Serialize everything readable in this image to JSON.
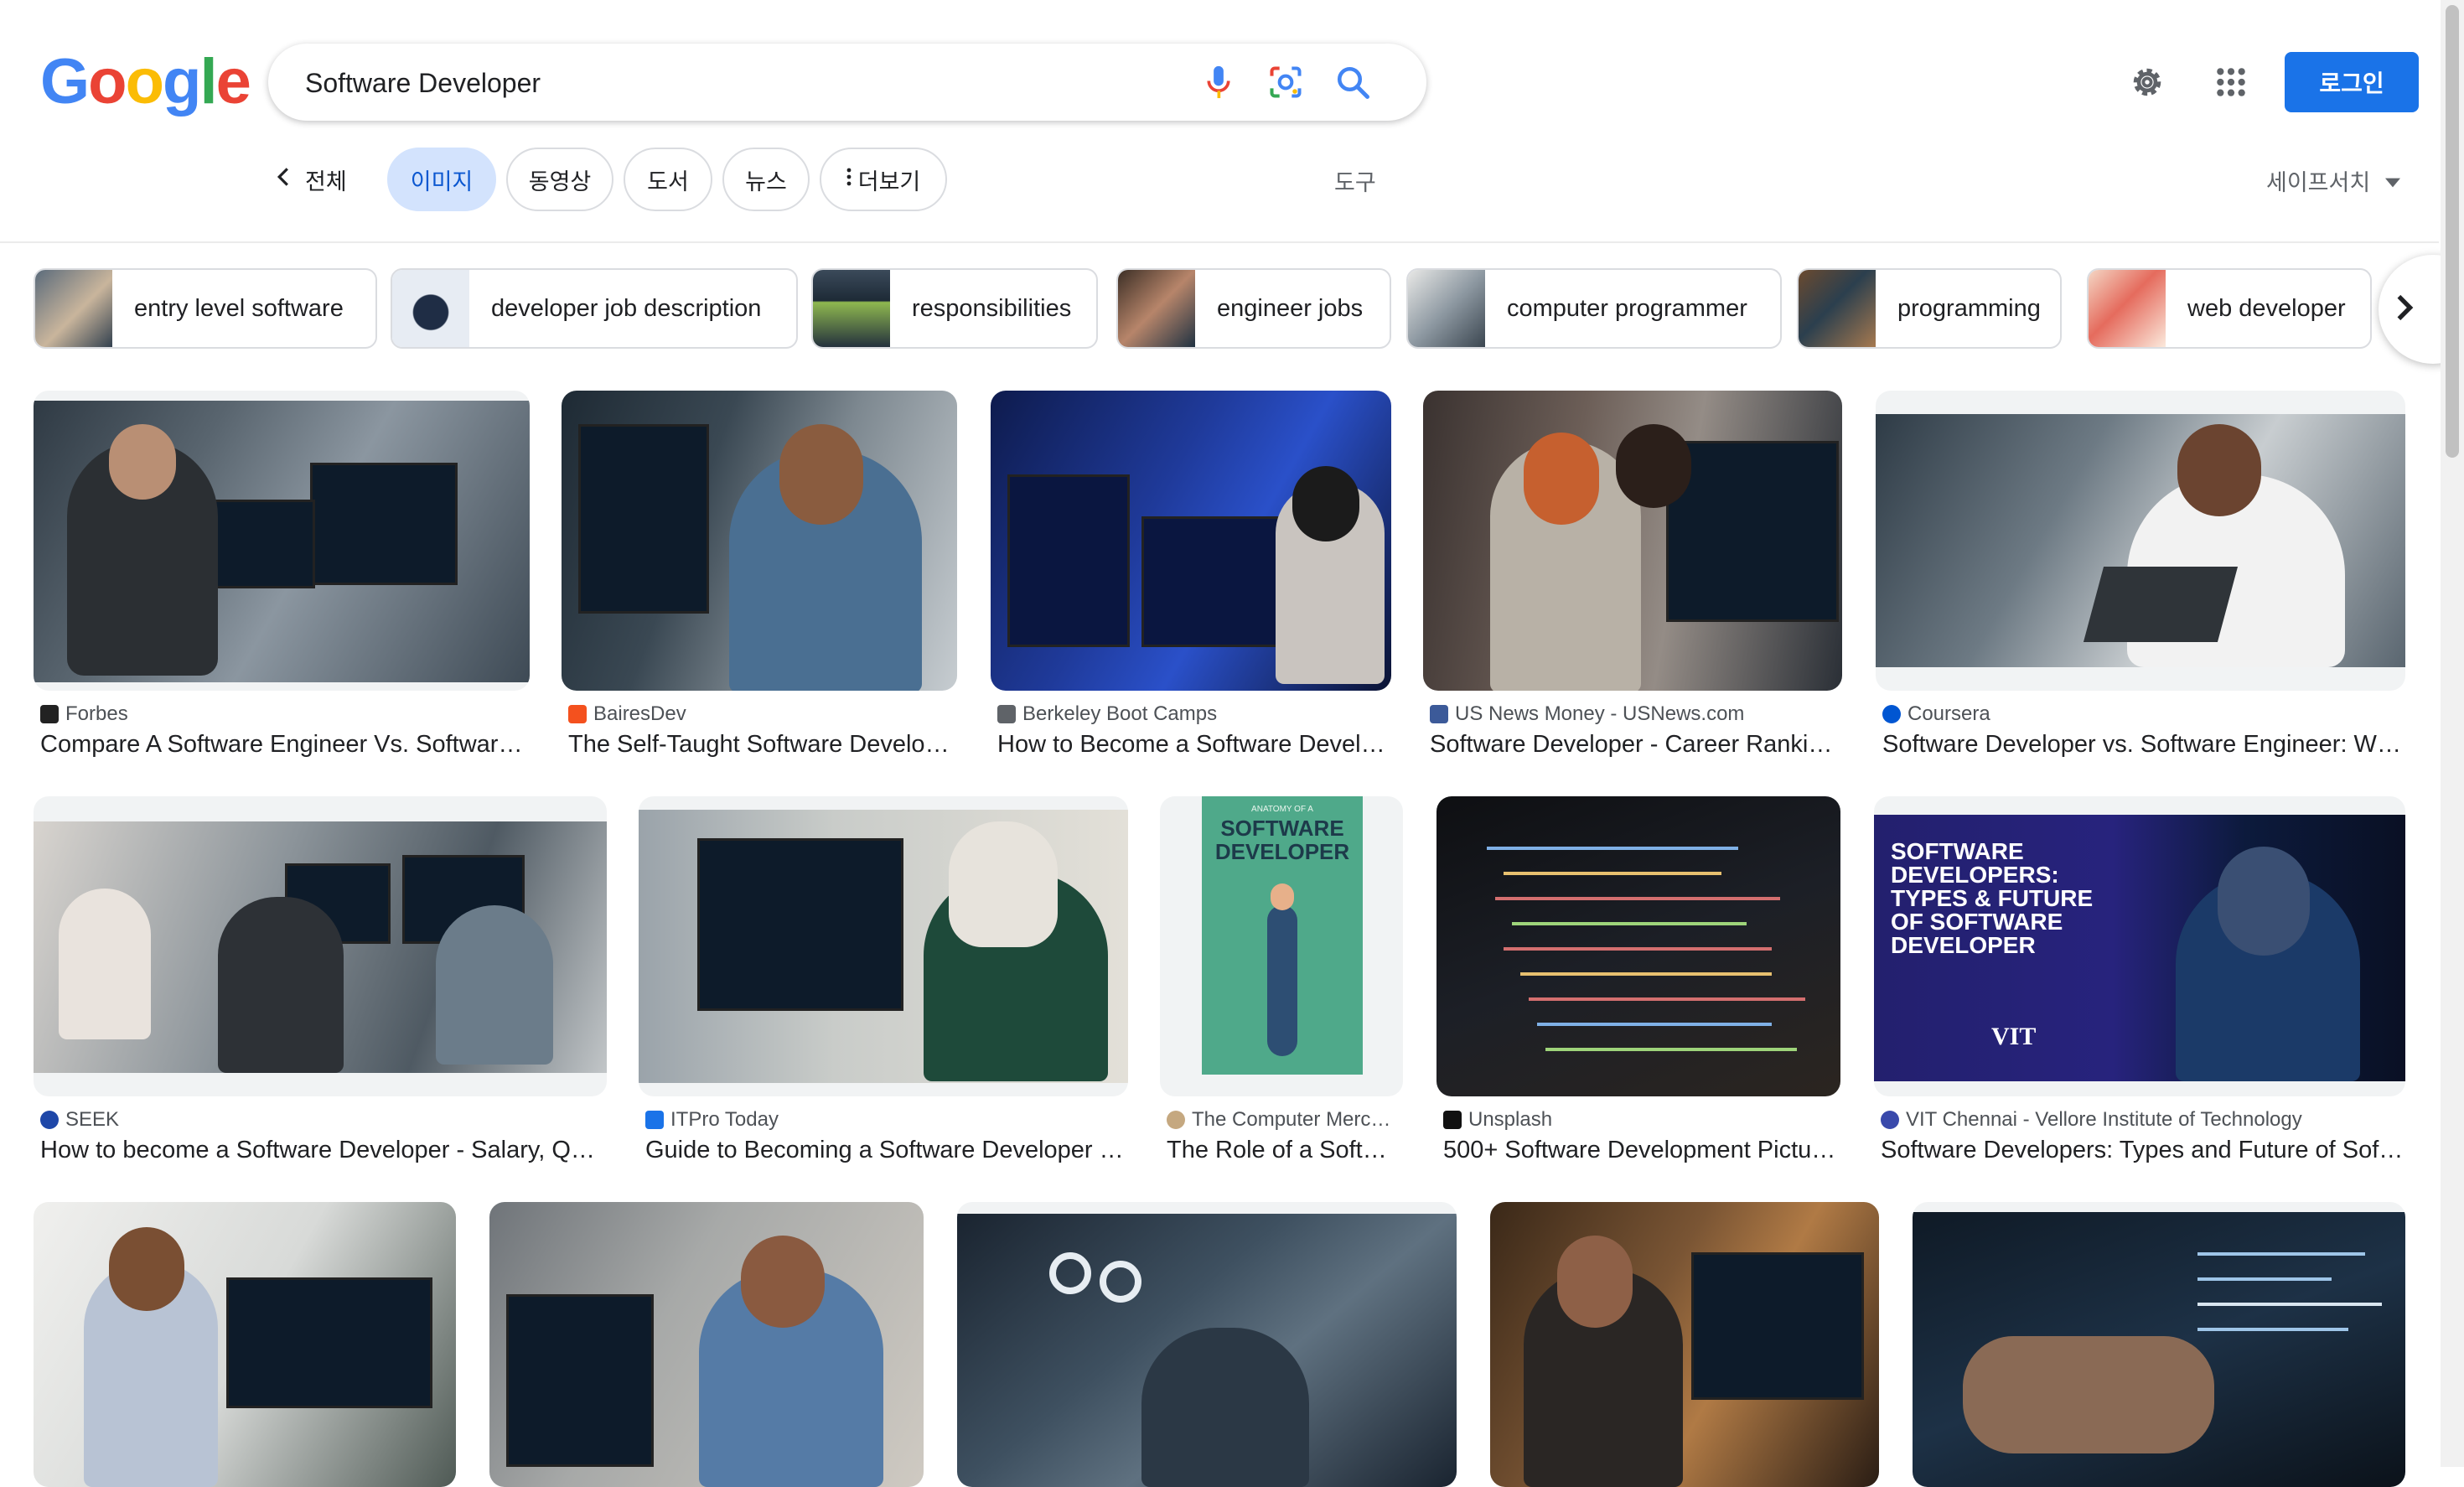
{
  "logo": {
    "letters": [
      "G",
      "o",
      "o",
      "g",
      "l",
      "e"
    ],
    "colors": [
      "#4285f4",
      "#ea4335",
      "#fbbc05",
      "#4285f4",
      "#34a853",
      "#ea4335"
    ]
  },
  "search": {
    "query": "Software Developer"
  },
  "header": {
    "login_label": "로그인"
  },
  "tabs": {
    "all": "전체",
    "images": "이미지",
    "videos": "동영상",
    "books": "도서",
    "news": "뉴스",
    "more": "더보기",
    "tools": "도구",
    "safesearch": "세이프서치"
  },
  "chips": [
    {
      "label": "entry level software"
    },
    {
      "label": "developer job description"
    },
    {
      "label": "responsibilities"
    },
    {
      "label": "engineer jobs"
    },
    {
      "label": "computer programmer"
    },
    {
      "label": "programming"
    },
    {
      "label": "web developer"
    }
  ],
  "results": [
    {
      "source": "Forbes",
      "title": "Compare A Software Engineer Vs. Software…",
      "favicon_color": "#222222"
    },
    {
      "source": "BairesDev",
      "title": "The Self-Taught Software Develop…",
      "favicon_color": "#f4511e"
    },
    {
      "source": "Berkeley Boot Camps",
      "title": "How to Become a Software Devel…",
      "favicon_color": "#5f6368"
    },
    {
      "source": "US News Money - USNews.com",
      "title": "Software Developer - Career Rankin…",
      "favicon_color": "#3c5a99"
    },
    {
      "source": "Coursera",
      "title": "Software Developer vs. Software Engineer: Wh…",
      "favicon_color": "#0056d2"
    },
    {
      "source": "SEEK",
      "title": "How to become a Software Developer - Salary, Qua…",
      "favicon_color": "#1e47a8"
    },
    {
      "source": "ITPro Today",
      "title": "Guide to Becoming a Software Developer | …",
      "favicon_color": "#1a73e8"
    },
    {
      "source": "The Computer Merc…",
      "title": "The Role of a Softw…",
      "favicon_color": "#c5a880"
    },
    {
      "source": "Unsplash",
      "title": "500+ Software Development Pictur…",
      "favicon_color": "#111111"
    },
    {
      "source": "VIT Chennai - Vellore Institute of Technology",
      "title": "Software Developers: Types and Future of Soft…",
      "favicon_color": "#3949ab"
    }
  ],
  "infographic": {
    "line1": "SOFTWARE",
    "line2": "DEVELOPER",
    "header": "ANATOMY OF A"
  },
  "vit_banner": {
    "lines": [
      "SOFTWARE",
      "DEVELOPERS:",
      "TYPES & FUTURE",
      "OF SOFTWARE",
      "DEVELOPER"
    ],
    "logo": "VIT"
  }
}
